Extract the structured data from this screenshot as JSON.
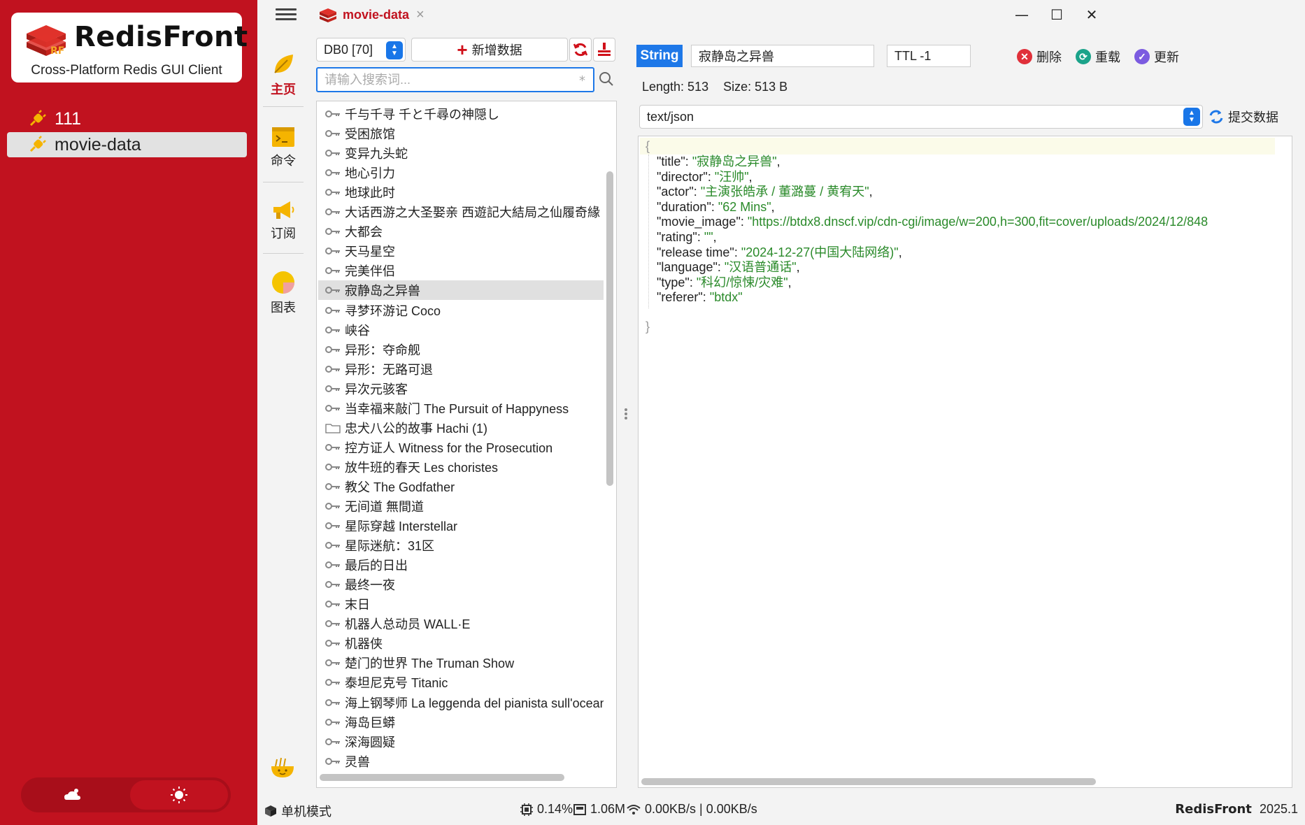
{
  "app": {
    "name": "RedisFront",
    "subtitle": "Cross-Platform Redis GUI Client",
    "version": "2025.1"
  },
  "connections": [
    {
      "label": "111",
      "active": false
    },
    {
      "label": "movie-data",
      "active": true
    }
  ],
  "tab": {
    "title": "movie-data",
    "close": "×"
  },
  "window_controls": {
    "minimize": "—",
    "maximize": "☐",
    "close": "✕"
  },
  "nav": [
    {
      "label": "主页",
      "icon": "leaf-icon",
      "active": true
    },
    {
      "label": "命令",
      "icon": "terminal-icon",
      "active": false
    },
    {
      "label": "订阅",
      "icon": "megaphone-icon",
      "active": false
    },
    {
      "label": "图表",
      "icon": "pie-chart-icon",
      "active": false
    }
  ],
  "keys_panel": {
    "db_select": "DB0 [70]",
    "add_label": "新增数据",
    "search_placeholder": "请输入搜索词...",
    "search_regex": "*",
    "keys": [
      {
        "label": "千与千寻 千と千尋の神隠し",
        "type": "key"
      },
      {
        "label": "受困旅馆",
        "type": "key"
      },
      {
        "label": "变异九头蛇",
        "type": "key"
      },
      {
        "label": "地心引力",
        "type": "key"
      },
      {
        "label": "地球此时",
        "type": "key"
      },
      {
        "label": "大话西游之大圣娶亲 西遊記大結局之仙履奇緣",
        "type": "key"
      },
      {
        "label": "大都会",
        "type": "key"
      },
      {
        "label": "天马星空",
        "type": "key"
      },
      {
        "label": "完美伴侣",
        "type": "key"
      },
      {
        "label": "寂静岛之异兽",
        "type": "key",
        "selected": true
      },
      {
        "label": "寻梦环游记 Coco",
        "type": "key"
      },
      {
        "label": "峡谷",
        "type": "key"
      },
      {
        "label": "异形：夺命舰",
        "type": "key"
      },
      {
        "label": "异形：无路可退",
        "type": "key"
      },
      {
        "label": "异次元骇客",
        "type": "key"
      },
      {
        "label": "当幸福来敲门 The Pursuit of Happyness",
        "type": "key"
      },
      {
        "label": "忠犬八公的故事 Hachi (1)",
        "type": "folder"
      },
      {
        "label": "控方证人 Witness for the Prosecution",
        "type": "key"
      },
      {
        "label": "放牛班的春天 Les choristes",
        "type": "key"
      },
      {
        "label": "教父 The Godfather",
        "type": "key"
      },
      {
        "label": "无间道 無間道",
        "type": "key"
      },
      {
        "label": "星际穿越 Interstellar",
        "type": "key"
      },
      {
        "label": "星际迷航：31区",
        "type": "key"
      },
      {
        "label": "最后的日出",
        "type": "key"
      },
      {
        "label": "最终一夜",
        "type": "key"
      },
      {
        "label": "末日",
        "type": "key"
      },
      {
        "label": "机器人总动员 WALL·E",
        "type": "key"
      },
      {
        "label": "机器侠",
        "type": "key"
      },
      {
        "label": "楚门的世界 The Truman Show",
        "type": "key"
      },
      {
        "label": "泰坦尼克号 Titanic",
        "type": "key"
      },
      {
        "label": "海上钢琴师 La leggenda del pianista sull'oceano",
        "type": "key"
      },
      {
        "label": "海岛巨蟒",
        "type": "key"
      },
      {
        "label": "深海圆疑",
        "type": "key"
      },
      {
        "label": "灵兽",
        "type": "key"
      }
    ]
  },
  "value_panel": {
    "type": "String",
    "key_name": "寂静岛之异兽",
    "ttl": "TTL -1",
    "delete_label": "删除",
    "reload_label": "重载",
    "update_label": "更新",
    "length": "Length: 513",
    "size": "Size: 513 B",
    "format": "text/json",
    "submit_label": "提交数据",
    "json_open": "{",
    "json_close": "}",
    "fields": [
      {
        "key": "\"title\"",
        "value": "\"寂静岛之异兽\"",
        "tail": ","
      },
      {
        "key": "\"director\"",
        "value": "\"汪帅\"",
        "tail": ","
      },
      {
        "key": "\"actor\"",
        "value": "\"主演张皓承 / 董潞蔓 / 黄宥天\"",
        "tail": ","
      },
      {
        "key": "\"duration\"",
        "value": "\"62 Mins\"",
        "tail": ","
      },
      {
        "key": "\"movie_image\"",
        "value": "\"https://btdx8.dnscf.vip/cdn-cgi/image/w=200,h=300,fit=cover/uploads/2024/12/848",
        "tail": ""
      },
      {
        "key": "\"rating\"",
        "value": "\"\"",
        "tail": ","
      },
      {
        "key": "\"release time\"",
        "value": "\"2024-12-27(中国大陆网络)\"",
        "tail": ","
      },
      {
        "key": "\"language\"",
        "value": "\"汉语普通话\"",
        "tail": ","
      },
      {
        "key": "\"type\"",
        "value": "\"科幻/惊悚/灾难\"",
        "tail": ","
      },
      {
        "key": "\"referer\"",
        "value": "\"btdx\"",
        "tail": ""
      }
    ]
  },
  "status": {
    "mode": "单机模式",
    "cpu": "0.14%",
    "memory": "1.06M",
    "network": "0.00KB/s | 0.00KB/s"
  },
  "colors": {
    "brand_red": "#c1121f",
    "accent_blue": "#1e78e8",
    "json_string": "#2a8a2a"
  }
}
